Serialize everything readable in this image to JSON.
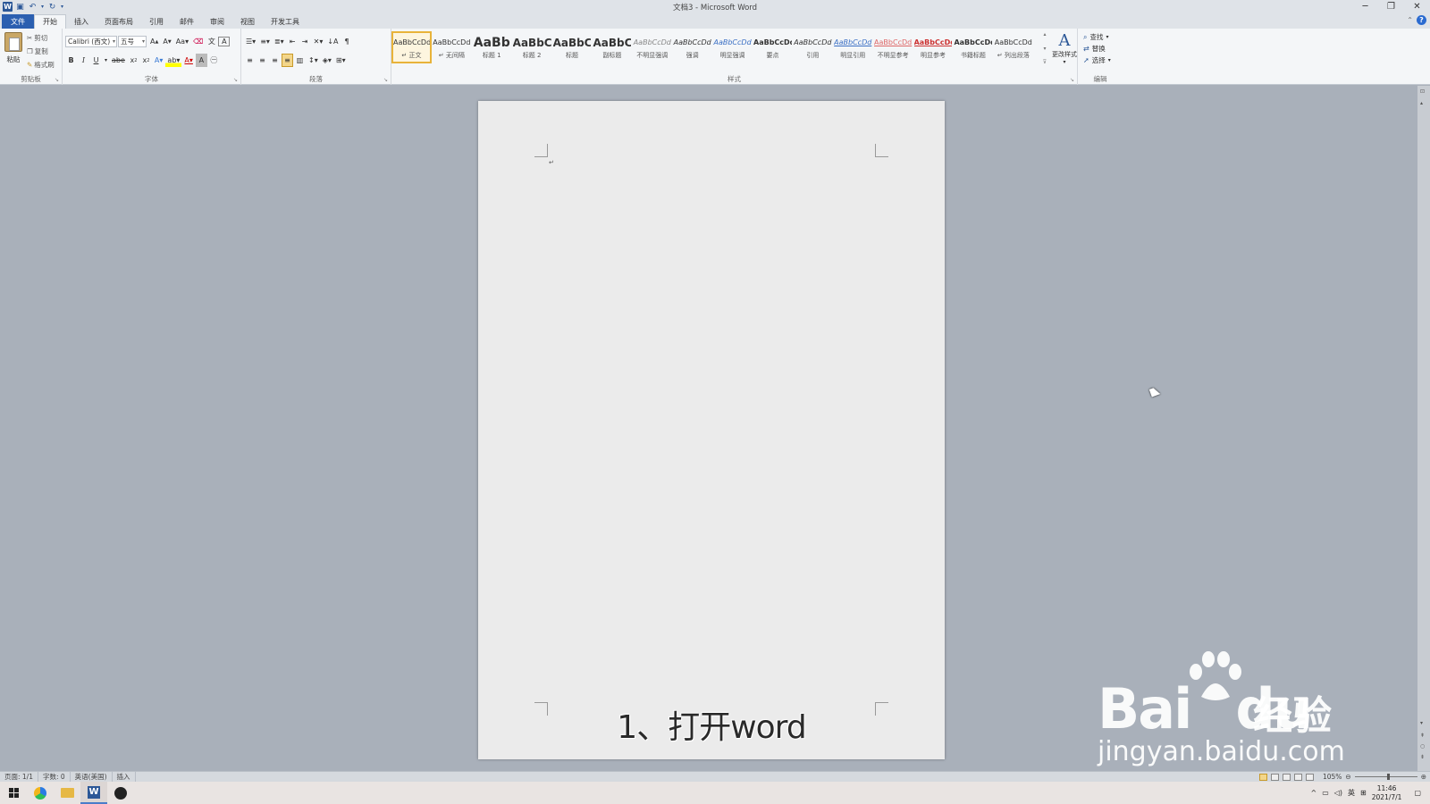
{
  "window": {
    "title": "文档3 - Microsoft Word",
    "controls": [
      "─",
      "❐",
      "✕"
    ]
  },
  "qat": {
    "word_icon": "W",
    "save_icon": "floppy-icon",
    "undo_icon": "undo-icon",
    "redo_icon": "redo-icon"
  },
  "tabs": {
    "file": "文件",
    "home": "开始",
    "insert": "插入",
    "layout": "页面布局",
    "references": "引用",
    "mailings": "邮件",
    "review": "审阅",
    "view": "视图",
    "developer": "开发工具"
  },
  "clipboard": {
    "paste": "粘贴",
    "cut": "剪切",
    "copy": "复制",
    "format_painter": "格式刷",
    "label": "剪贴板"
  },
  "font": {
    "name": "Calibri (西文)",
    "size": "五号",
    "label": "字体"
  },
  "paragraph": {
    "label": "段落"
  },
  "styles": {
    "label": "样式",
    "items": [
      {
        "preview": "AaBbCcDd",
        "name": "↵ 正文"
      },
      {
        "preview": "AaBbCcDd",
        "name": "↵ 无间隔"
      },
      {
        "preview": "AaBb",
        "name": "标题 1"
      },
      {
        "preview": "AaBbC",
        "name": "标题 2"
      },
      {
        "preview": "AaBbC",
        "name": "标题"
      },
      {
        "preview": "AaBbC",
        "name": "副标题"
      },
      {
        "preview": "AaBbCcDd",
        "name": "不明显强调"
      },
      {
        "preview": "AaBbCcDd",
        "name": "强调"
      },
      {
        "preview": "AaBbCcDd",
        "name": "明显强调"
      },
      {
        "preview": "AaBbCcDd",
        "name": "要点"
      },
      {
        "preview": "AaBbCcDd",
        "name": "引用"
      },
      {
        "preview": "AaBbCcDd",
        "name": "明显引用"
      },
      {
        "preview": "AaBbCcDd",
        "name": "不明显参考"
      },
      {
        "preview": "AaBbCcDd",
        "name": "明显参考"
      },
      {
        "preview": "AaBbCcDd",
        "name": "书籍标题"
      },
      {
        "preview": "AaBbCcDd",
        "name": "↵ 列出段落"
      }
    ],
    "change_styles": "更改样式"
  },
  "editing": {
    "find": "查找",
    "replace": "替换",
    "select": "选择",
    "label": "编辑"
  },
  "document": {
    "subtitle": "1、打开word"
  },
  "status": {
    "page": "页面: 1/1",
    "words": "字数: 0",
    "language": "英语(美国)",
    "mode": "插入",
    "zoom": "105%"
  },
  "taskbar": {
    "time": "11:46",
    "date": "2021/7/1",
    "ime": "英"
  },
  "watermark": {
    "brand": "Bai",
    "brand_du": "du",
    "cn": "经验",
    "url": "jingyan.baidu.com"
  },
  "colors": {
    "accent": "#2b5797",
    "file_tab": "#2b5fb0",
    "selected_style": "#e8b33a",
    "workspace": "#a9b0ba"
  }
}
